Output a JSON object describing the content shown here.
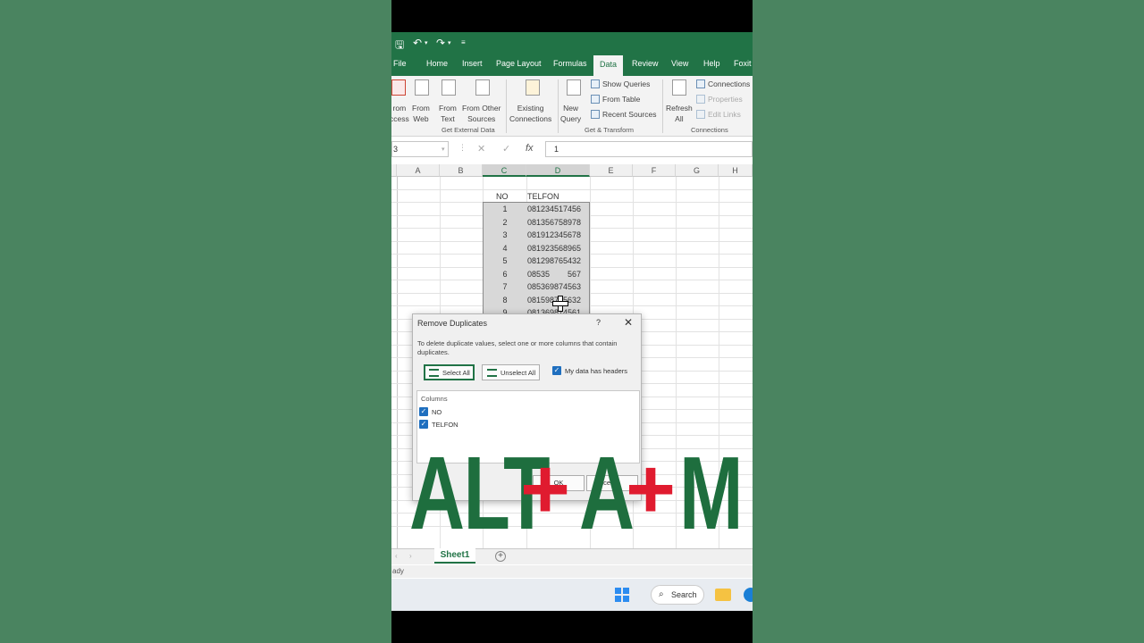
{
  "qat": {
    "undo": "↶",
    "redo": "↷"
  },
  "tabs": [
    {
      "label": "File"
    },
    {
      "label": "Home"
    },
    {
      "label": "Insert"
    },
    {
      "label": "Page Layout"
    },
    {
      "label": "Formulas"
    },
    {
      "label": "Data"
    },
    {
      "label": "Review"
    },
    {
      "label": "View"
    },
    {
      "label": "Help"
    },
    {
      "label": "Foxit"
    }
  ],
  "ribbon": {
    "from_access": "rom\nccess",
    "from_web": "From\nWeb",
    "from_text": "From\nText",
    "from_other": "From Other\nSources",
    "existing": "Existing\nConnections",
    "new_query": "New\nQuery",
    "show_queries": "Show Queries",
    "from_table": "From Table",
    "recent_sources": "Recent Sources",
    "refresh_all": "Refresh\nAll",
    "connections": "Connections",
    "properties": "Properties",
    "edit_links": "Edit Links",
    "group_external": "Get External Data",
    "group_transform": "Get & Transform",
    "group_connections": "Connections"
  },
  "formula_bar": {
    "name_box": "3",
    "value": "1",
    "fx": "fx"
  },
  "columns": [
    "A",
    "B",
    "C",
    "D",
    "E",
    "F",
    "G",
    "H"
  ],
  "table": {
    "headers": [
      "NO",
      "TELFON"
    ],
    "rows": [
      [
        "1",
        "081234517456"
      ],
      [
        "2",
        "081356758978"
      ],
      [
        "3",
        "081912345678"
      ],
      [
        "4",
        "081923568965"
      ],
      [
        "5",
        "081298765432"
      ],
      [
        "6",
        "08535",
        "567"
      ],
      [
        "7",
        "085369874563"
      ],
      [
        "8",
        "081598745632"
      ],
      [
        "9",
        "081369874561"
      ]
    ]
  },
  "dialog": {
    "title": "Remove Duplicates",
    "help": "?",
    "close": "✕",
    "description": "To delete duplicate values, select one or more columns that contain duplicates.",
    "select_all": "Select All",
    "unselect_all": "Unselect All",
    "my_data_headers": "My data has headers",
    "columns_header": "Columns",
    "column_items": [
      "NO",
      "TELFON"
    ],
    "ok": "OK",
    "cancel": "ncel"
  },
  "sheet": {
    "tab": "Sheet1",
    "add": "+",
    "status": "ady"
  },
  "taskbar": {
    "search": "Search"
  },
  "overlay": {
    "alt": "ALT",
    "plus1": "+",
    "a": "A",
    "plus2": "+",
    "m": "M"
  }
}
